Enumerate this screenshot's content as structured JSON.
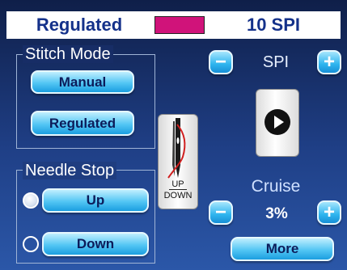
{
  "header": {
    "mode_display": "Regulated",
    "color_swatch": "#d0137a",
    "spi_display": "10 SPI"
  },
  "stitch_mode": {
    "title": "Stitch Mode",
    "manual_label": "Manual",
    "regulated_label": "Regulated"
  },
  "needle_stop": {
    "title": "Needle Stop",
    "up_label": "Up",
    "down_label": "Down",
    "selected": "Up"
  },
  "needle_widget": {
    "up_text": "UP",
    "down_text": "DOWN"
  },
  "spi": {
    "label": "SPI",
    "minus_glyph": "−",
    "plus_glyph": "+"
  },
  "cruise": {
    "label": "Cruise",
    "value": "3%",
    "minus_glyph": "−",
    "plus_glyph": "+"
  },
  "more_label": "More",
  "colors": {
    "accent_text": "#14318a",
    "button_light": "#53c6f4",
    "background_top": "#0f1f49",
    "background_bottom": "#2b57a8"
  }
}
